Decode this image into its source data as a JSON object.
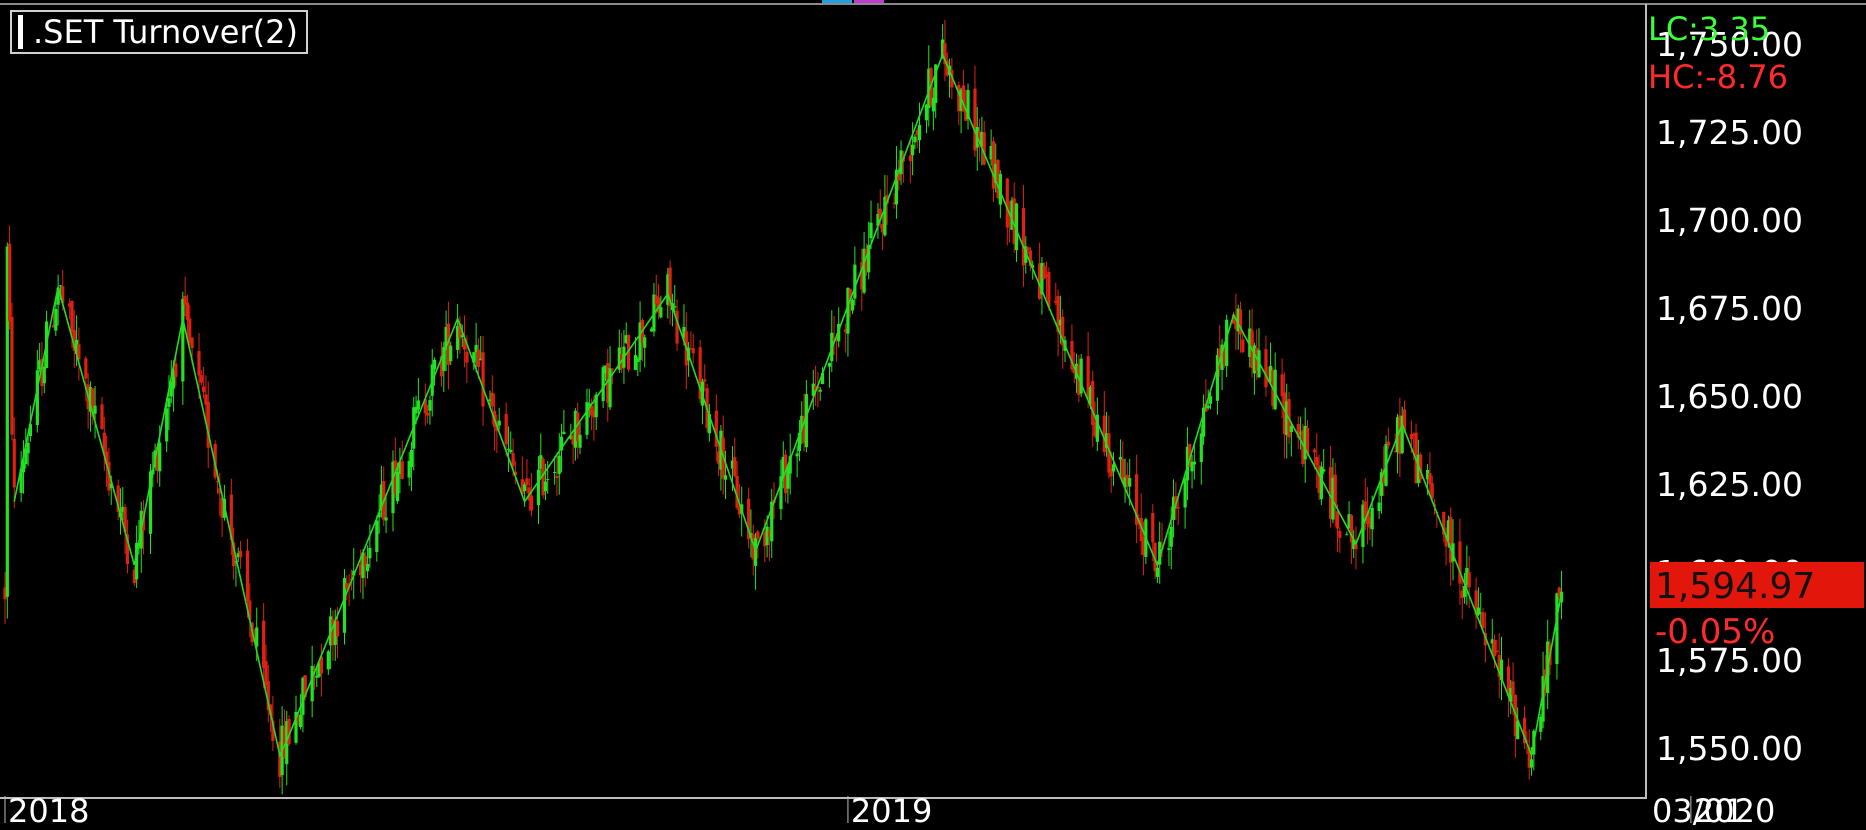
{
  "header": {
    "title": ".SET Turnover(2)",
    "lc_label": "LC:3.35",
    "hc_label": "HC:-8.76"
  },
  "price_box": {
    "last": "1,594.97",
    "change_pct": "-0.05%"
  },
  "date_label": "03/01",
  "colors": {
    "up": "#22e322",
    "down": "#e02012",
    "zigzag": "#22dd22",
    "axis_text": "#ffffff",
    "price_box_bg": "#e3160b"
  },
  "chart_data": {
    "type": "candlestick",
    "title": ".SET Turnover(2)",
    "x_tick_labels": [
      "2018",
      "2019",
      "2020"
    ],
    "y_tick_labels": [
      "1,750.00",
      "1,725.00",
      "1,700.00",
      "1,675.00",
      "1,650.00",
      "1,625.00",
      "1,600.00",
      "1,575.00",
      "1,550.00"
    ],
    "ylim": [
      1540,
      1760
    ],
    "grid": false,
    "last_price": 1594.97,
    "last_change_pct": -0.05,
    "zigzag": [
      {
        "date": "2018-01-05",
        "value": 1620
      },
      {
        "date": "2018-01-24",
        "value": 1681
      },
      {
        "date": "2018-02-26",
        "value": 1602
      },
      {
        "date": "2018-03-19",
        "value": 1672
      },
      {
        "date": "2018-04-30",
        "value": 1548
      },
      {
        "date": "2018-05-03",
        "value": 1552
      },
      {
        "date": "2018-07-16",
        "value": 1672
      },
      {
        "date": "2018-08-14",
        "value": 1620
      },
      {
        "date": "2018-10-15",
        "value": 1679
      },
      {
        "date": "2018-11-22",
        "value": 1606
      },
      {
        "date": "2019-02-11",
        "value": 1747
      },
      {
        "date": "2019-05-15",
        "value": 1602
      },
      {
        "date": "2019-06-17",
        "value": 1673
      },
      {
        "date": "2019-08-09",
        "value": 1608
      },
      {
        "date": "2019-08-29",
        "value": 1642
      },
      {
        "date": "2019-10-24",
        "value": 1548
      },
      {
        "date": "2019-11-06",
        "value": 1594
      }
    ],
    "series": [
      {
        "name": "",
        "type": "candlestick",
        "points": [
          {
            "date": "2018-01-02",
            "value": 1690
          },
          {
            "date": "2018-01-05",
            "value": 1620
          },
          {
            "date": "2018-01-24",
            "value": 1681
          },
          {
            "date": "2018-02-26",
            "value": 1602
          },
          {
            "date": "2018-03-19",
            "value": 1672
          },
          {
            "date": "2018-04-30",
            "value": 1548
          },
          {
            "date": "2018-07-16",
            "value": 1672
          },
          {
            "date": "2018-08-14",
            "value": 1620
          },
          {
            "date": "2018-10-15",
            "value": 1679
          },
          {
            "date": "2018-11-22",
            "value": 1606
          },
          {
            "date": "2019-02-11",
            "value": 1747
          },
          {
            "date": "2019-03-14",
            "value": 1700
          },
          {
            "date": "2019-05-15",
            "value": 1602
          },
          {
            "date": "2019-06-17",
            "value": 1673
          },
          {
            "date": "2019-08-09",
            "value": 1608
          },
          {
            "date": "2019-08-29",
            "value": 1642
          },
          {
            "date": "2019-10-24",
            "value": 1548
          },
          {
            "date": "2019-11-06",
            "value": 1594.97
          }
        ]
      }
    ]
  }
}
